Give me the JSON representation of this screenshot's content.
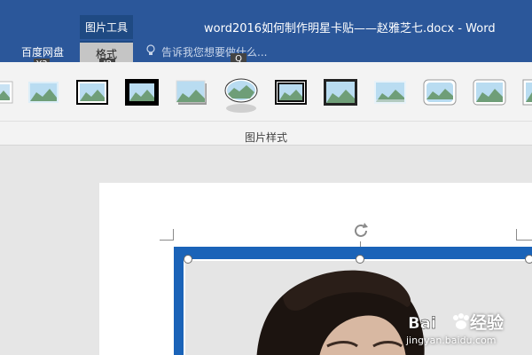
{
  "window": {
    "context_tab_group": "图片工具",
    "title": "word2016如何制作明星卡贴——赵雅芝七.docx - Word"
  },
  "ribbon_tabs": {
    "baidu": "百度网盘",
    "format": "格式"
  },
  "tell_me": {
    "placeholder": "告诉我您想要做什么..."
  },
  "keytips": {
    "baidu": "Y3",
    "format": "JP",
    "tell_me": "Q"
  },
  "picture_styles": {
    "group_label": "图片样式",
    "styles": [
      {
        "name": "simple-frame-white-partial"
      },
      {
        "name": "soft-edge-rectangle"
      },
      {
        "name": "double-frame-black"
      },
      {
        "name": "thick-matte-black"
      },
      {
        "name": "drop-shadow-rectangle"
      },
      {
        "name": "oval-reflection"
      },
      {
        "name": "metal-frame-black"
      },
      {
        "name": "center-shadow-rectangle"
      },
      {
        "name": "soft-edge-rectangle-2"
      },
      {
        "name": "rounded-diagonal-corner"
      },
      {
        "name": "snip-diagonal-corner"
      },
      {
        "name": "reflected-bevel-partial"
      }
    ]
  },
  "watermark": {
    "brand": "经验",
    "url": "jingyan.baidu.com"
  }
}
